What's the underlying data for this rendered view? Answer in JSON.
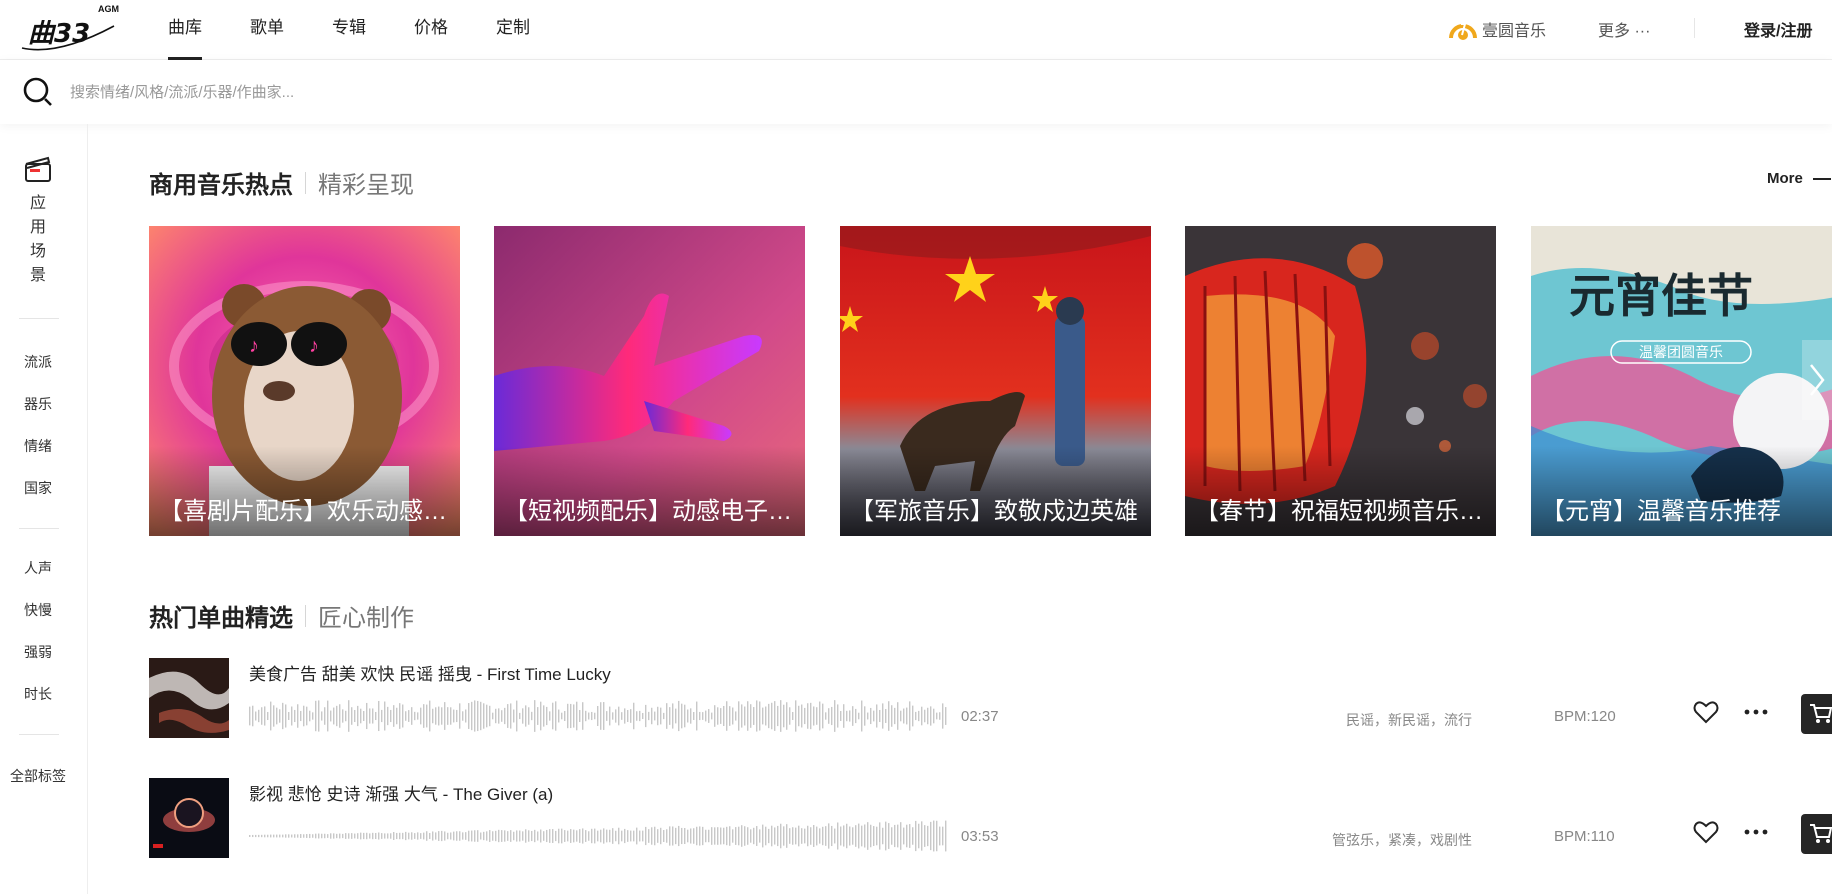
{
  "logo": {
    "text": "曲多多",
    "badge": "AGM"
  },
  "nav": {
    "links": [
      "曲库",
      "歌单",
      "专辑",
      "价格",
      "定制"
    ],
    "brand": "壹圆音乐",
    "more": "更多 ···",
    "login": "登录/注册"
  },
  "search": {
    "placeholder": "搜索情绪/风格/流派/乐器/作曲家..."
  },
  "sidebar": {
    "scene": "应用场景",
    "group1": [
      "流派",
      "器乐",
      "情绪",
      "国家"
    ],
    "group2": [
      "人声",
      "快慢",
      "强弱",
      "时长"
    ],
    "all_tags": "全部标签"
  },
  "hot_section": {
    "title": "商用音乐热点",
    "subtitle": "精彩呈现",
    "more": "More"
  },
  "cards": [
    {
      "title": "【喜剧片配乐】欢乐动感俏皮",
      "theme": "dog-in-bear-costume"
    },
    {
      "title": "【短视频配乐】动感电子氛围",
      "theme": "rock-hand"
    },
    {
      "title": "【军旅音乐】致敬戍边英雄",
      "theme": "soldier-and-flag"
    },
    {
      "title": "【春节】祝福短视频音乐推荐",
      "theme": "red-lantern"
    },
    {
      "title": "【元宵】温馨音乐推荐",
      "theme": "lantern-festival-poster",
      "poster_heading": "元宵佳节",
      "poster_sub": "温馨团圆音乐"
    }
  ],
  "single_section": {
    "title": "热门单曲精选",
    "subtitle": "匠心制作"
  },
  "tracks": [
    {
      "title": "美食广告 甜美 欢快 民谣 摇曳 - First Time Lucky",
      "duration": "02:37",
      "tags": "民谣，新民谣，流行",
      "bpm": "BPM:120",
      "played_fraction": 0
    },
    {
      "title": "影视 悲怆 史诗 渐强 大气 - The Giver (a)",
      "duration": "03:53",
      "tags": "管弦乐，紧凑，戏剧性",
      "bpm": "BPM:110",
      "played_fraction": 0
    }
  ],
  "colors": {
    "accent": "#222222",
    "brand_gold": "#f0a81c",
    "cart_bg": "#262626",
    "muted": "#888888"
  }
}
